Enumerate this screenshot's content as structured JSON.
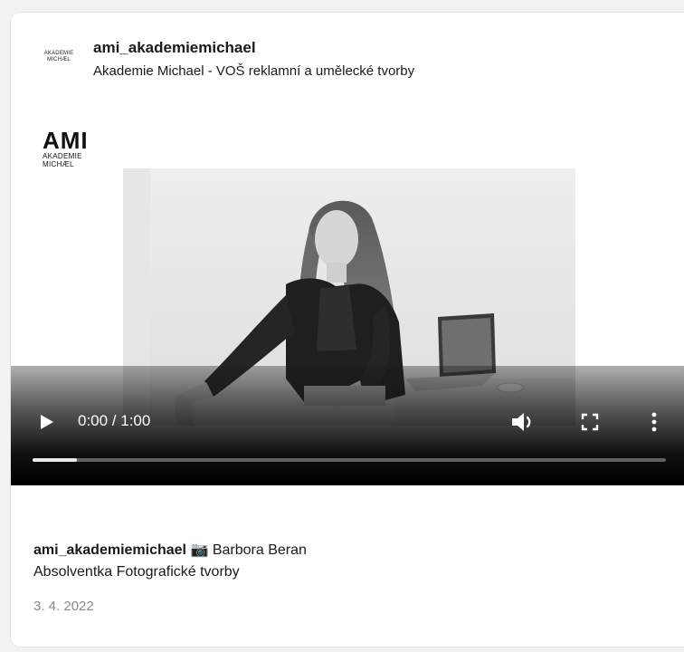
{
  "header": {
    "logo_lines": [
      "AKADEMIE",
      "MICHÆL"
    ],
    "username": "ami_akademiemichael",
    "subtitle": "Akademie Michael - VOŠ reklamní a umělecké tvorby"
  },
  "media": {
    "logo": {
      "big": "AMI",
      "line1": "AKADEMIE",
      "line2": "MICHÆL"
    },
    "player": {
      "time": "0:00 / 1:00",
      "progress_fraction": 0.07,
      "icons": {
        "play": "play-icon",
        "volume": "volume-icon",
        "fullscreen": "fullscreen-icon",
        "more": "more-vertical-icon"
      }
    }
  },
  "caption": {
    "user": "ami_akademiemichael",
    "camera_emoji": "📷",
    "name": "Barbora Beran",
    "line2": "Absolventka Fotografické tvorby"
  },
  "date": "3. 4. 2022"
}
